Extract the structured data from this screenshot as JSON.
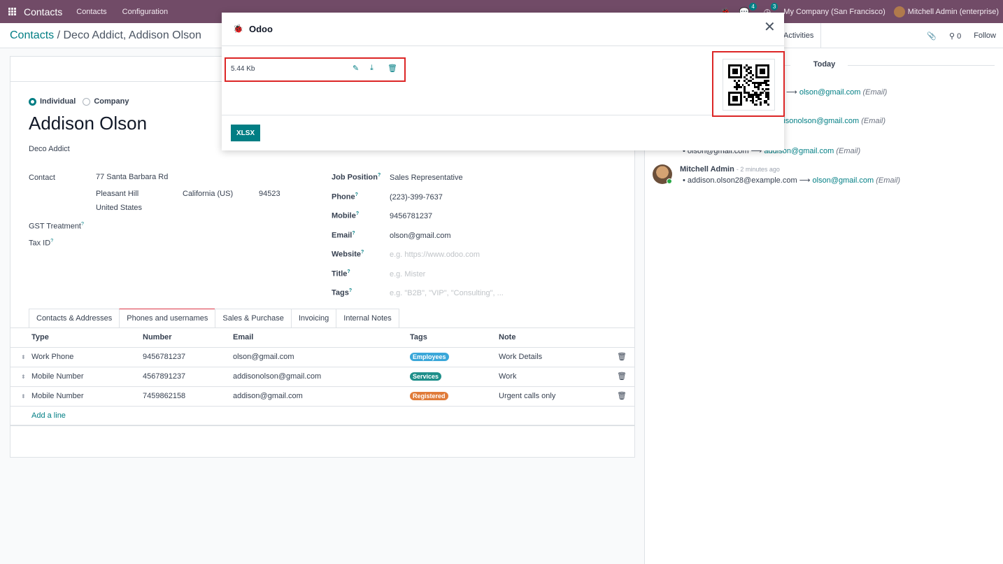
{
  "navbar": {
    "brand": "Contacts",
    "menu": [
      "Contacts",
      "Configuration"
    ],
    "messages_count": "4",
    "activities_count": "3",
    "company": "My Company (San Francisco)",
    "user": "Mitchell Admin (enterprise)"
  },
  "control": {
    "breadcrumb_root": "Contacts",
    "breadcrumb_sep": "/",
    "breadcrumb_current": "Deco Addict, Addison Olson",
    "activities": "Activities",
    "followers": "0",
    "follow": "Follow"
  },
  "form": {
    "type_individual": "Individual",
    "type_company": "Company",
    "name": "Addison Olson",
    "company": "Deco Addict",
    "contact_label": "Contact",
    "street": "77 Santa Barbara Rd",
    "city": "Pleasant Hill",
    "state": "California (US)",
    "zip": "94523",
    "country": "United States",
    "gst_label": "GST Treatment",
    "taxid_label": "Tax ID",
    "job_position_label": "Job Position",
    "job_position": "Sales Representative",
    "phone_label": "Phone",
    "phone": "(223)-399-7637",
    "mobile_label": "Mobile",
    "mobile": "9456781237",
    "email_label": "Email",
    "email": "olson@gmail.com",
    "website_label": "Website",
    "website_placeholder": "e.g. https://www.odoo.com",
    "title_label": "Title",
    "title_placeholder": "e.g. Mister",
    "tags_label": "Tags",
    "tags_placeholder": "e.g. \"B2B\", \"VIP\", \"Consulting\", ...",
    "help_mark": "?"
  },
  "tabs": [
    "Contacts & Addresses",
    "Phones and usernames",
    "Sales & Purchase",
    "Invoicing",
    "Internal Notes"
  ],
  "table": {
    "headers": [
      "Type",
      "Number",
      "Email",
      "Tags",
      "Note"
    ],
    "rows": [
      {
        "type": "Work Phone",
        "number": "9456781237",
        "email": "olson@gmail.com",
        "tag": "Employees",
        "tag_color": "#3aa7d9",
        "note": "Work Details"
      },
      {
        "type": "Mobile Number",
        "number": "4567891237",
        "email": "addisonolson@gmail.com",
        "tag": "Services",
        "tag_color": "#1f8f8a",
        "note": "Work"
      },
      {
        "type": "Mobile Number",
        "number": "7459862158",
        "email": "addison@gmail.com",
        "tag": "Registered",
        "tag_color": "#e07b39",
        "note": "Urgent calls only"
      }
    ],
    "add_line": "Add a line"
  },
  "chatter": {
    "today": "Today",
    "arrow": "⟶",
    "email_tag": "(Email)",
    "msg1_new": "olson@gmail.com",
    "msg2_new": "addisonolson@gmail.com",
    "msg3_old": "olson@gmail.com",
    "msg3_new": "addison@gmail.com",
    "msg4_author": "Mitchell Admin",
    "msg4_time": "- 2 minutes ago",
    "msg4_old": "addison.olson28@example.com",
    "msg4_new": "olson@gmail.com"
  },
  "dialog": {
    "title": "Odoo",
    "file_size": "5.44 Kb",
    "export_button": "XLSX"
  }
}
